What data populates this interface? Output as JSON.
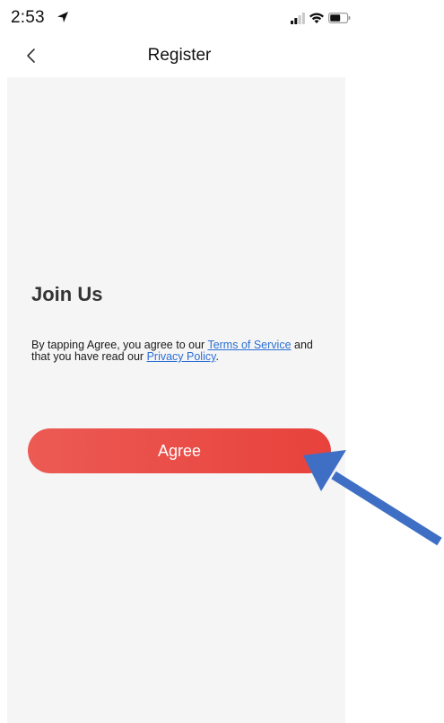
{
  "status_bar": {
    "time": "2:53"
  },
  "nav": {
    "title": "Register"
  },
  "content": {
    "heading": "Join Us",
    "terms_prefix": "By tapping Agree, you agree to our ",
    "terms_link": "Terms of Service",
    "terms_middle": " and that you have read our ",
    "privacy_link": "Privacy Policy",
    "terms_suffix": ".",
    "agree_label": "Agree"
  },
  "colors": {
    "accent": "#e8423c",
    "link": "#2b6fd4",
    "background": "#f5f5f6",
    "annotation_arrow": "#3f6fc4"
  }
}
